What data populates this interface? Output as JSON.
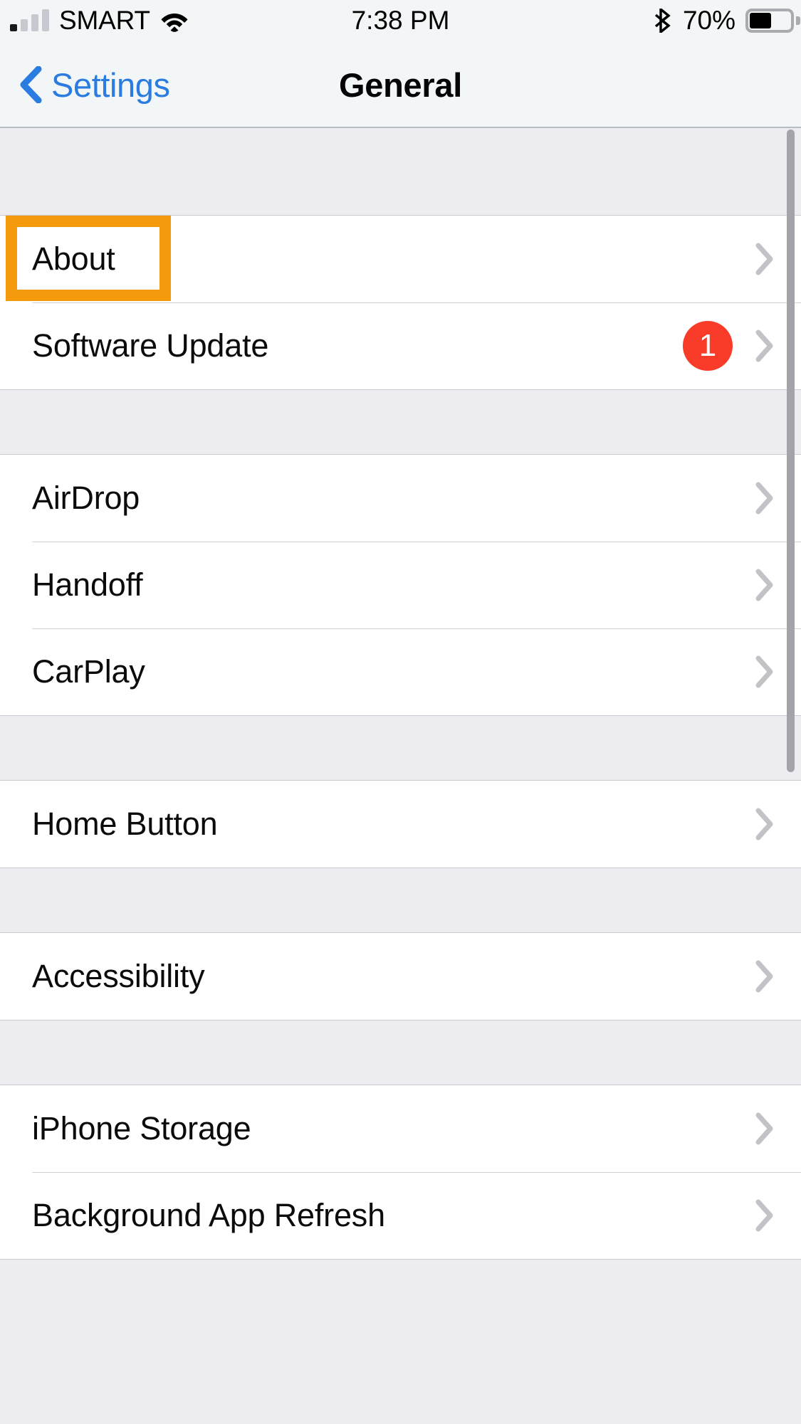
{
  "status_bar": {
    "carrier": "SMART",
    "signal_icon": "cellular-bars-icon",
    "wifi_icon": "wifi-icon",
    "time": "7:38 PM",
    "bluetooth_icon": "bluetooth-icon",
    "battery_percent": "70%",
    "battery_level": 70,
    "battery_icon": "battery-icon"
  },
  "nav": {
    "back_label": "Settings",
    "back_icon": "chevron-left-icon",
    "title": "General"
  },
  "colors": {
    "accent_blue": "#2a7ce0",
    "badge_red": "#f93b2a",
    "highlight_orange": "#f59a0c",
    "group_background": "#ffffff",
    "page_background": "#ededf1",
    "bar_background": "#f2f6f7"
  },
  "sections": [
    {
      "rows": [
        {
          "label": "About",
          "chevron": "chevron-right-icon",
          "badge": null,
          "highlighted": true
        },
        {
          "label": "Software Update",
          "chevron": "chevron-right-icon",
          "badge": "1",
          "highlighted": false
        }
      ]
    },
    {
      "rows": [
        {
          "label": "AirDrop",
          "chevron": "chevron-right-icon",
          "badge": null,
          "highlighted": false
        },
        {
          "label": "Handoff",
          "chevron": "chevron-right-icon",
          "badge": null,
          "highlighted": false
        },
        {
          "label": "CarPlay",
          "chevron": "chevron-right-icon",
          "badge": null,
          "highlighted": false
        }
      ]
    },
    {
      "rows": [
        {
          "label": "Home Button",
          "chevron": "chevron-right-icon",
          "badge": null,
          "highlighted": false
        }
      ]
    },
    {
      "rows": [
        {
          "label": "Accessibility",
          "chevron": "chevron-right-icon",
          "badge": null,
          "highlighted": false
        }
      ]
    },
    {
      "rows": [
        {
          "label": "iPhone Storage",
          "chevron": "chevron-right-icon",
          "badge": null,
          "highlighted": false
        },
        {
          "label": "Background App Refresh",
          "chevron": "chevron-right-icon",
          "badge": null,
          "highlighted": false
        }
      ]
    }
  ],
  "layout": {
    "gaps": [
      120,
      90,
      90,
      90,
      90,
      120
    ]
  },
  "scrollbar": {
    "visible": true
  }
}
